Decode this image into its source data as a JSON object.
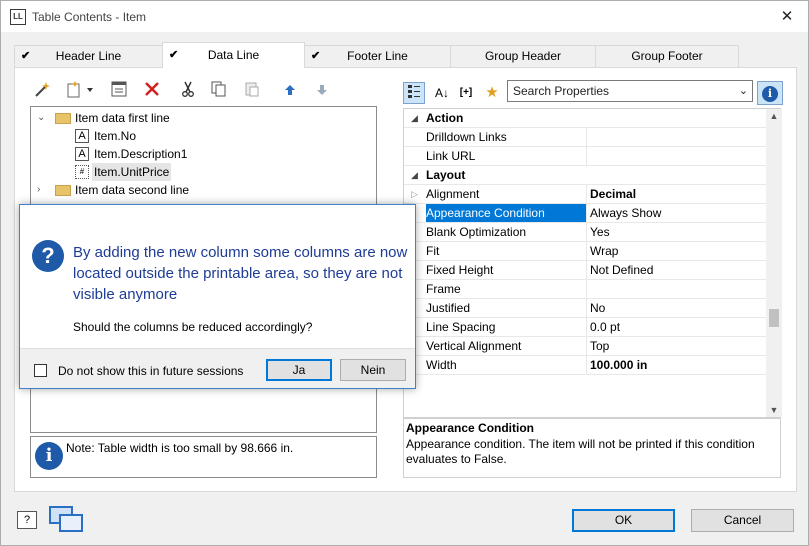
{
  "window": {
    "app_badge": "LL",
    "title": "Table Contents - Item",
    "close_glyph": "✕"
  },
  "tabs": [
    {
      "label": "Header Line",
      "checked": true
    },
    {
      "label": "Data Line",
      "checked": true
    },
    {
      "label": "Footer Line",
      "checked": true
    },
    {
      "label": "Group Header",
      "checked": false
    },
    {
      "label": "Group Footer",
      "checked": false
    }
  ],
  "left_toolbar": [
    "magic-wand-icon",
    "new-item-icon",
    "properties-icon",
    "delete-icon",
    "cut-icon",
    "copy-icon",
    "paste-icon",
    "move-up-icon",
    "move-down-icon"
  ],
  "tree": {
    "items": [
      {
        "label": "Item data first line",
        "type": "folder",
        "expanded": true
      },
      {
        "label": "Item.No",
        "type": "text"
      },
      {
        "label": "Item.Description1",
        "type": "text"
      },
      {
        "label": "Item.UnitPrice",
        "type": "text",
        "selected": true
      },
      {
        "label": "Item data second line",
        "type": "folder",
        "expanded": false
      }
    ]
  },
  "note": {
    "text": "Note: Table width is too small by 98.666 in."
  },
  "properties": {
    "toolbar_glyphs": [
      "A↓",
      "[+]",
      "★"
    ],
    "search_placeholder": "Search Properties",
    "rows": [
      {
        "name": "Action",
        "category": true
      },
      {
        "name": "Drilldown Links",
        "value": ""
      },
      {
        "name": "Link URL",
        "value": ""
      },
      {
        "name": "Layout",
        "category": true
      },
      {
        "name": "Alignment",
        "value": "Decimal",
        "bold": true,
        "expandable": true
      },
      {
        "name": "Appearance Condition",
        "value": "Always Show",
        "selected": true
      },
      {
        "name": "Blank Optimization",
        "value": "Yes"
      },
      {
        "name": "Fit",
        "value": "Wrap"
      },
      {
        "name": "Fixed Height",
        "value": "Not Defined"
      },
      {
        "name": "Frame",
        "value": ""
      },
      {
        "name": "Justified",
        "value": "No"
      },
      {
        "name": "Line Spacing",
        "value": "0.0 pt"
      },
      {
        "name": "Vertical Alignment",
        "value": "Top"
      },
      {
        "name": "Width",
        "value": "100.000 in",
        "bold": true
      }
    ],
    "description": {
      "title": "Appearance Condition",
      "text": "Appearance condition. The item will not be printed if this condition evaluates to False."
    }
  },
  "dialog": {
    "message": "By adding the new column some columns are now located outside the printable area, so they are not visible anymore",
    "question": "Should the columns be reduced accordingly?",
    "checkbox_label": "Do not show this in future sessions",
    "yes_label": "Ja",
    "no_label": "Nein"
  },
  "footer": {
    "ok_label": "OK",
    "cancel_label": "Cancel",
    "help_glyph": "?"
  },
  "colors": {
    "accent": "#0078d7",
    "dialog_text": "#1e3c96",
    "icon_blue": "#1e5aa8"
  }
}
